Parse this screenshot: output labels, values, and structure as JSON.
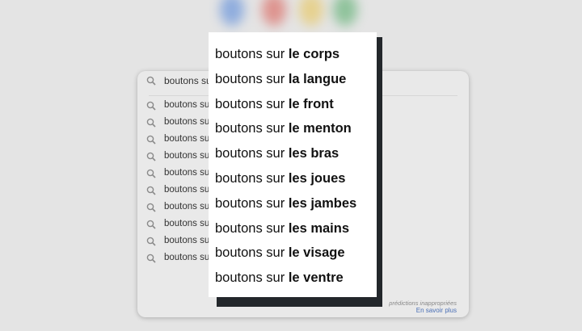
{
  "search": {
    "query": "boutons su"
  },
  "background_suggestions": [
    "boutons su",
    "boutons su",
    "boutons su",
    "boutons su",
    "boutons su",
    "boutons su",
    "boutons su",
    "boutons su",
    "boutons su",
    "boutons su"
  ],
  "overlay_suggestions": [
    {
      "prefix": "boutons sur ",
      "completion": "le corps"
    },
    {
      "prefix": "boutons sur ",
      "completion": "la langue"
    },
    {
      "prefix": "boutons sur ",
      "completion": "le front"
    },
    {
      "prefix": "boutons sur ",
      "completion": "le menton"
    },
    {
      "prefix": "boutons sur ",
      "completion": "les bras"
    },
    {
      "prefix": "boutons sur ",
      "completion": "les joues"
    },
    {
      "prefix": "boutons sur ",
      "completion": "les jambes"
    },
    {
      "prefix": "boutons sur ",
      "completion": "les mains"
    },
    {
      "prefix": "boutons sur ",
      "completion": "le visage"
    },
    {
      "prefix": "boutons sur ",
      "completion": "le ventre"
    }
  ],
  "footer": {
    "report_text": "prédictions inappropriées",
    "learn_more": "En savoir plus"
  },
  "colors": {
    "background": "#e4e4e4",
    "card": "#e9e9e9",
    "overlay": "#ffffff",
    "overlay_shadow": "#23272b",
    "link": "#4a6fb5"
  },
  "icons": {
    "search": "magnifier-icon"
  }
}
